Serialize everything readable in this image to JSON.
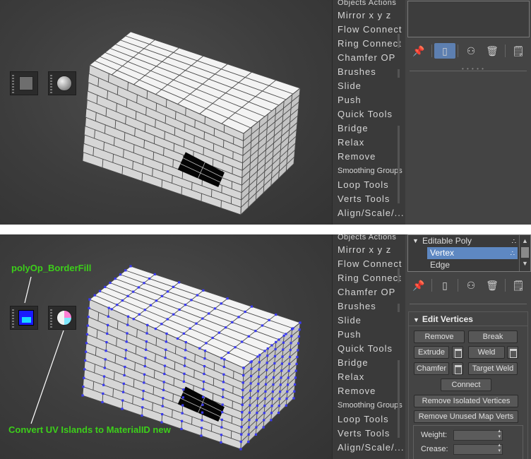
{
  "top": {
    "menu_items": [
      {
        "label": "Objects Actions",
        "cls": "first"
      },
      {
        "label": "Mirror   x y z"
      },
      {
        "label": "Flow Connect"
      },
      {
        "label": "Ring Connect"
      },
      {
        "label": "Chamfer OP"
      },
      {
        "label": "Brushes"
      },
      {
        "label": "Slide"
      },
      {
        "label": "Push"
      },
      {
        "label": "Quick Tools"
      },
      {
        "label": "Bridge"
      },
      {
        "label": "Relax"
      },
      {
        "label": "Remove"
      },
      {
        "label": "Smoothing Groups",
        "cls": "small"
      },
      {
        "label": "Loop Tools"
      },
      {
        "label": "Verts Tools"
      },
      {
        "label": "Align/Scale/..."
      }
    ]
  },
  "bottom": {
    "annotations": {
      "border_fill": "polyOp_BorderFill",
      "convert_uv": "Convert UV Islands to MaterialID new"
    },
    "menu_items": [
      {
        "label": "Objects Actions",
        "cls": "first"
      },
      {
        "label": "Mirror   x y z"
      },
      {
        "label": "Flow Connect"
      },
      {
        "label": "Ring Connect"
      },
      {
        "label": "Chamfer OP"
      },
      {
        "label": "Brushes"
      },
      {
        "label": "Slide"
      },
      {
        "label": "Push"
      },
      {
        "label": "Quick Tools"
      },
      {
        "label": "Bridge"
      },
      {
        "label": "Relax"
      },
      {
        "label": "Remove"
      },
      {
        "label": "Smoothing Groups",
        "cls": "small"
      },
      {
        "label": "Loop Tools"
      },
      {
        "label": "Verts Tools"
      },
      {
        "label": "Align/Scale/..."
      }
    ],
    "modifier_stack": {
      "root": "Editable Poly",
      "selected": "Vertex",
      "next": "Edge"
    },
    "edit_vertices": {
      "title": "Edit Vertices",
      "remove": "Remove",
      "break": "Break",
      "extrude": "Extrude",
      "weld": "Weld",
      "chamfer": "Chamfer",
      "target_weld": "Target Weld",
      "connect": "Connect",
      "remove_isolated": "Remove Isolated Vertices",
      "remove_unused": "Remove Unused Map Verts",
      "weight_label": "Weight:",
      "crease_label": "Crease:"
    }
  },
  "colors": {
    "annotation": "#3ccf1a",
    "selection": "#5e88c2",
    "vertex_dot": "#3a3af0"
  },
  "icons": [
    "square-material-icon",
    "sphere-material-icon",
    "poly-border-fill-icon",
    "uv-islands-icon",
    "pin-icon",
    "modifier-icon",
    "unique-icon",
    "trash-icon",
    "configure-icon"
  ]
}
